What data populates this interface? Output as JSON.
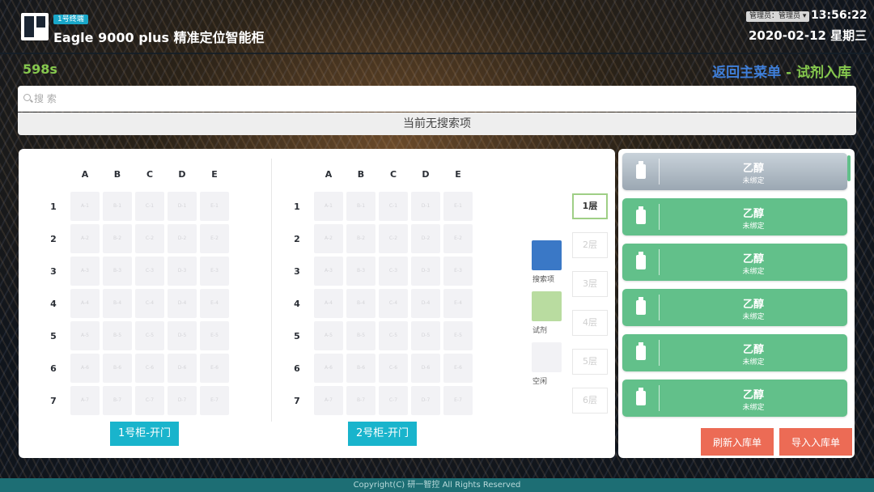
{
  "header": {
    "terminal_badge": "1号终端",
    "app_title": "Eagle 9000 plus 精准定位智能柜",
    "admin_badge": "管理员：管理员 ▾",
    "clock": "13:56:22",
    "date": "2020-02-12 星期三"
  },
  "timer": "598s",
  "nav": {
    "back_label": "返回主菜单",
    "separator": " - ",
    "page_label": "试剂入库"
  },
  "search": {
    "placeholder": "搜 索",
    "status": "当前无搜索项"
  },
  "cabinets": [
    {
      "columns": [
        "A",
        "B",
        "C",
        "D",
        "E"
      ],
      "rows": [
        "1",
        "2",
        "3",
        "4",
        "5",
        "6",
        "7"
      ],
      "cells": [
        [
          "A-1",
          "B-1",
          "C-1",
          "D-1",
          "E-1"
        ],
        [
          "A-2",
          "B-2",
          "C-2",
          "D-2",
          "E-2"
        ],
        [
          "A-3",
          "B-3",
          "C-3",
          "D-3",
          "E-3"
        ],
        [
          "A-4",
          "B-4",
          "C-4",
          "D-4",
          "E-4"
        ],
        [
          "A-5",
          "B-5",
          "C-5",
          "D-5",
          "E-5"
        ],
        [
          "A-6",
          "B-6",
          "C-6",
          "D-6",
          "E-6"
        ],
        [
          "A-7",
          "B-7",
          "C-7",
          "D-7",
          "E-7"
        ]
      ],
      "open_label": "1号柜-开门"
    },
    {
      "columns": [
        "A",
        "B",
        "C",
        "D",
        "E"
      ],
      "rows": [
        "1",
        "2",
        "3",
        "4",
        "5",
        "6",
        "7"
      ],
      "cells": [
        [
          "A-1",
          "B-1",
          "C-1",
          "D-1",
          "E-1"
        ],
        [
          "A-2",
          "B-2",
          "C-2",
          "D-2",
          "E-2"
        ],
        [
          "A-3",
          "B-3",
          "C-3",
          "D-3",
          "E-3"
        ],
        [
          "A-4",
          "B-4",
          "C-4",
          "D-4",
          "E-4"
        ],
        [
          "A-5",
          "B-5",
          "C-5",
          "D-5",
          "E-5"
        ],
        [
          "A-6",
          "B-6",
          "C-6",
          "D-6",
          "E-6"
        ],
        [
          "A-7",
          "B-7",
          "C-7",
          "D-7",
          "E-7"
        ]
      ],
      "open_label": "2号柜-开门"
    }
  ],
  "legend": [
    {
      "label": "搜索项",
      "color": "#3a78c6"
    },
    {
      "label": "试剂",
      "color": "#b9dca0"
    },
    {
      "label": "空闲",
      "color": "#f2f2f5"
    }
  ],
  "layers": [
    {
      "label": "1层",
      "active": true
    },
    {
      "label": "2层",
      "active": false
    },
    {
      "label": "3层",
      "active": false
    },
    {
      "label": "4层",
      "active": false
    },
    {
      "label": "5层",
      "active": false
    },
    {
      "label": "6层",
      "active": false
    }
  ],
  "reagents": [
    {
      "name": "乙醇",
      "status": "未绑定",
      "selected": true
    },
    {
      "name": "乙醇",
      "status": "未绑定",
      "selected": false
    },
    {
      "name": "乙醇",
      "status": "未绑定",
      "selected": false
    },
    {
      "name": "乙醇",
      "status": "未绑定",
      "selected": false
    },
    {
      "name": "乙醇",
      "status": "未绑定",
      "selected": false
    },
    {
      "name": "乙醇",
      "status": "未绑定",
      "selected": false
    }
  ],
  "actions": {
    "refresh_label": "刷新入库单",
    "import_label": "导入入库单"
  },
  "footer": "Copyright(C) 研一智控 All Rights Reserved",
  "colors": {
    "accent_green": "#62c08a",
    "accent_blue": "#3f7fd9",
    "open_button": "#19b4cc",
    "action_button": "#ec6b55"
  }
}
